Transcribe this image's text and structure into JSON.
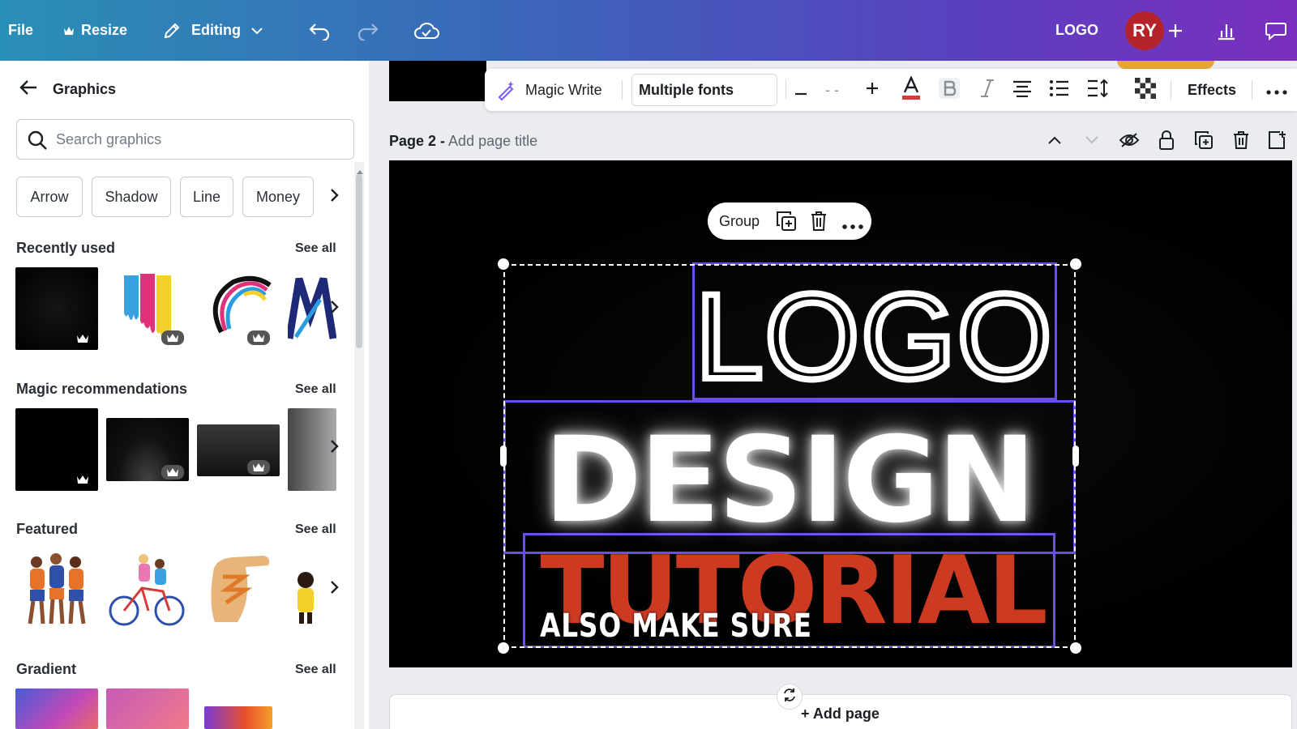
{
  "topbar": {
    "file_label": "File",
    "resize_label": "Resize",
    "editing_label": "Editing",
    "design_name": "LOGO",
    "avatar_initials": "RY"
  },
  "panel": {
    "title": "Graphics",
    "search_placeholder": "Search graphics",
    "chips": [
      "Arrow",
      "Shadow",
      "Line",
      "Money"
    ],
    "sections": {
      "recent": {
        "title": "Recently used",
        "see_all": "See all"
      },
      "magic": {
        "title": "Magic recommendations",
        "see_all": "See all"
      },
      "featured": {
        "title": "Featured",
        "see_all": "See all"
      },
      "gradient": {
        "title": "Gradient",
        "see_all": "See all"
      }
    }
  },
  "toolbar": {
    "magic_write": "Magic Write",
    "font_name": "Multiple fonts",
    "font_size": "- -",
    "effects": "Effects"
  },
  "page": {
    "label": "Page 2 -",
    "title_placeholder": "Add page title",
    "add_page": "+ Add page"
  },
  "group_toolbar": {
    "label": "Group"
  },
  "canvas": {
    "line1": "LOGO",
    "line2": "DESIGN",
    "line3": "TUTORIAL",
    "caption": "ALSO MAKE SURE"
  },
  "colors": {
    "accent_purple": "#6b4ee8",
    "tutorial_red": "#cc3a22",
    "avatar_red": "#b4232a"
  }
}
